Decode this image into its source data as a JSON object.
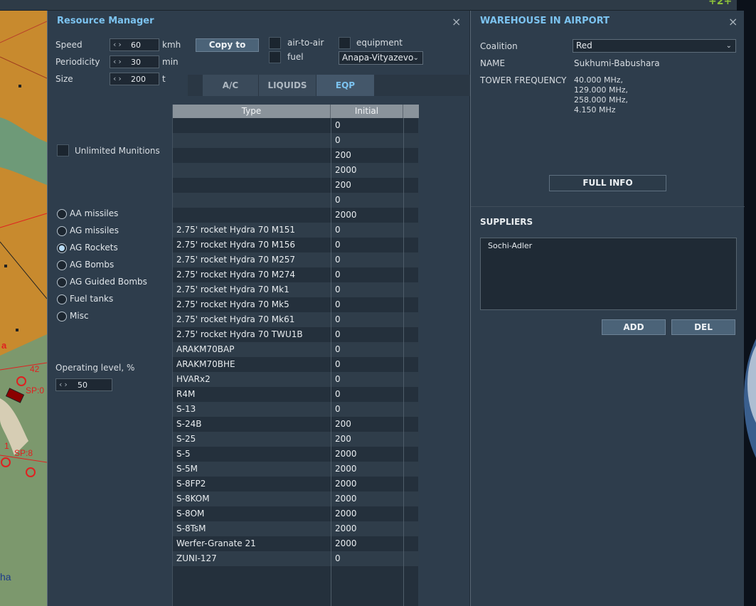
{
  "resource_manager": {
    "title": "Resource Manager",
    "speed": {
      "label": "Speed",
      "value": "60",
      "unit": "kmh"
    },
    "periodicity": {
      "label": "Periodicity",
      "value": "30",
      "unit": "min"
    },
    "size": {
      "label": "Size",
      "value": "200",
      "unit": "t"
    },
    "copy_to_label": "Copy to",
    "checkboxes": {
      "air_to_air": "air-to-air",
      "fuel": "fuel",
      "equipment": "equipment"
    },
    "copy_target": "Anapa-Vityazevo",
    "tabs": [
      {
        "label": "A/C",
        "active": false
      },
      {
        "label": "LIQUIDS",
        "active": false
      },
      {
        "label": "EQP",
        "active": true
      }
    ],
    "unlimited_munitions_label": "Unlimited Munitions",
    "categories": [
      {
        "label": "AA missiles",
        "selected": false
      },
      {
        "label": "AG missiles",
        "selected": false
      },
      {
        "label": "AG Rockets",
        "selected": true
      },
      {
        "label": "AG Bombs",
        "selected": false
      },
      {
        "label": "AG Guided Bombs",
        "selected": false
      },
      {
        "label": "Fuel tanks",
        "selected": false
      },
      {
        "label": "Misc",
        "selected": false
      }
    ],
    "operating_level": {
      "label": "Operating level, %",
      "value": "50"
    },
    "table": {
      "columns": [
        "Type",
        "Initial"
      ],
      "rows": [
        {
          "type": "",
          "initial": "0"
        },
        {
          "type": "",
          "initial": "0"
        },
        {
          "type": "",
          "initial": "200"
        },
        {
          "type": "",
          "initial": "2000"
        },
        {
          "type": "",
          "initial": "200"
        },
        {
          "type": "",
          "initial": "0"
        },
        {
          "type": "",
          "initial": "2000"
        },
        {
          "type": "2.75' rocket Hydra 70 M151",
          "initial": "0"
        },
        {
          "type": "2.75' rocket Hydra 70 M156",
          "initial": "0"
        },
        {
          "type": "2.75' rocket Hydra 70 M257",
          "initial": "0"
        },
        {
          "type": "2.75' rocket Hydra 70 M274",
          "initial": "0"
        },
        {
          "type": "2.75' rocket Hydra 70 Mk1",
          "initial": "0"
        },
        {
          "type": "2.75' rocket Hydra 70 Mk5",
          "initial": "0"
        },
        {
          "type": "2.75' rocket Hydra 70 Mk61",
          "initial": "0"
        },
        {
          "type": "2.75' rocket Hydra 70 TWU1B",
          "initial": "0"
        },
        {
          "type": "ARAKM70BAP",
          "initial": "0"
        },
        {
          "type": "ARAKM70BHE",
          "initial": "0"
        },
        {
          "type": "HVARx2",
          "initial": "0"
        },
        {
          "type": "R4M",
          "initial": "0"
        },
        {
          "type": "S-13",
          "initial": "0"
        },
        {
          "type": "S-24B",
          "initial": "200"
        },
        {
          "type": "S-25",
          "initial": "200"
        },
        {
          "type": "S-5",
          "initial": "2000"
        },
        {
          "type": "S-5M",
          "initial": "2000"
        },
        {
          "type": "S-8FP2",
          "initial": "2000"
        },
        {
          "type": "S-8KOM",
          "initial": "2000"
        },
        {
          "type": "S-8OM",
          "initial": "2000"
        },
        {
          "type": "S-8TsM",
          "initial": "2000"
        },
        {
          "type": "Werfer-Granate 21",
          "initial": "2000"
        },
        {
          "type": "ZUNI-127",
          "initial": "0"
        }
      ]
    }
  },
  "warehouse": {
    "title": "WAREHOUSE IN AIRPORT",
    "coalition": {
      "label": "Coalition",
      "value": "Red"
    },
    "name": {
      "label": "NAME",
      "value": "Sukhumi-Babushara"
    },
    "tower_frequency": {
      "label": "TOWER FREQUENCY",
      "values": [
        "40.000 MHz,",
        "129.000 MHz,",
        "258.000 MHz,",
        "4.150 MHz"
      ]
    },
    "full_info_label": "FULL INFO",
    "suppliers_title": "SUPPLIERS",
    "suppliers": [
      "Sochi-Adler"
    ],
    "add_label": "ADD",
    "del_label": "DEL"
  },
  "map_labels": {
    "marker_1": "42",
    "marker_2": "SP:0",
    "marker_3": "1",
    "marker_4": "SP:8",
    "bottom": "ha",
    "red_text": "a",
    "top_right": "+2+"
  },
  "colors": {
    "accent": "#7cc3f0",
    "panel": "#2e3d4c",
    "map": "#c88a2e"
  }
}
